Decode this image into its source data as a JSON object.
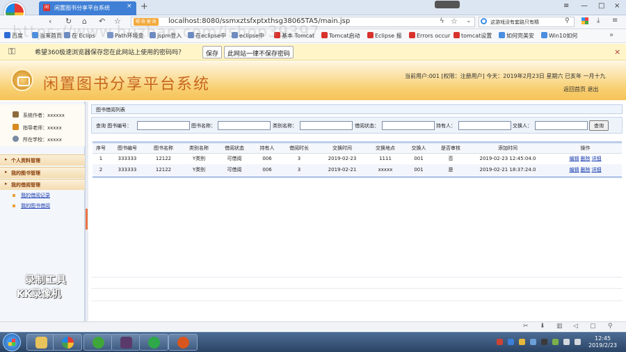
{
  "browser": {
    "tab_title": "闲置图书分享平台系统",
    "tab_close": "×",
    "new_tab": "+",
    "window_controls": [
      "≡",
      "—",
      "□",
      "×"
    ],
    "addr_badge": "嗯·奇·更·改",
    "url": "localhost:8080/ssmxztsfxptxthsg38065TA5/main.jsp",
    "search_placeholder": "这游戏没有套路只有精",
    "bookmarks": [
      "百度",
      "当来首页",
      "在 Eclips",
      "Path环境变",
      "jspm登入",
      "在eclipse中",
      "eclipse中",
      "基本 Tomcat",
      "Tomcat启动",
      "Eclipse 报",
      "Errors occur",
      "tomcat设置",
      "如何完美安",
      "Win10如何"
    ],
    "nav_icons": [
      "back-icon",
      "forward-icon",
      "home-icon",
      "refresh-icon",
      "star-icon"
    ]
  },
  "password_bar": {
    "message": "希望360极速浏览器保存您在此网站上使用的密码吗？",
    "save": "保存",
    "never": "此网站一律不保存密码",
    "close": "×"
  },
  "overlay_watermark": "https://www.huzhan.com/ishop39397",
  "app": {
    "title": "闲置图书分享平台系统",
    "user_info": "当前用户:001 [权限：注册用户] 今天：2019年2月23日 星期六 已亥年 一月十九",
    "head_links": "返回首页 退出"
  },
  "sidebar": {
    "info": [
      {
        "label": "系统作者：xxxxxx",
        "color": "#8e6b3e"
      },
      {
        "label": "指导老师：xxxxx",
        "color": "#d88a1e"
      },
      {
        "label": "所在学校：xxxxx",
        "color": "#7a8aa3"
      }
    ],
    "menus": [
      {
        "label": "个人资料管理"
      },
      {
        "label": "我的图书管理"
      },
      {
        "label": "我的借阅管理"
      }
    ],
    "submenus": [
      "我的借阅记录",
      "我的图书借阅"
    ],
    "watermark_line1": "录制工具",
    "watermark_line2": "KK录像机"
  },
  "main": {
    "panel_title": "图书借阅列表",
    "search": {
      "prefix": "查询 图书编号：",
      "book_name": "图书名称：",
      "category": "类别名称：",
      "status": "借阅状态：",
      "holder": "持有人：",
      "exchanger": "交换人：",
      "button": "查询"
    },
    "columns": [
      "序号",
      "图书编号",
      "图书名称",
      "类别名称",
      "借阅状态",
      "持有人",
      "借阅时长",
      "交换时间",
      "交换地点",
      "交换人",
      "是否审核",
      "添加时间",
      "操作"
    ],
    "rows": [
      [
        "1",
        "333333",
        "12122",
        "Y类别",
        "可借阅",
        "006",
        "3",
        "2019-02-23",
        "1111",
        "001",
        "否",
        "2019-02-23 12:45:04.0"
      ],
      [
        "2",
        "333333",
        "12122",
        "Y类别",
        "可借阅",
        "006",
        "3",
        "2019-02-21",
        "xxxxx",
        "001",
        "是",
        "2019-02-21 18:37:24.0"
      ]
    ],
    "actions": [
      "编辑",
      "删除",
      "详细"
    ]
  },
  "taskbar": {
    "time": "12:45",
    "date": "2019/2/23"
  }
}
